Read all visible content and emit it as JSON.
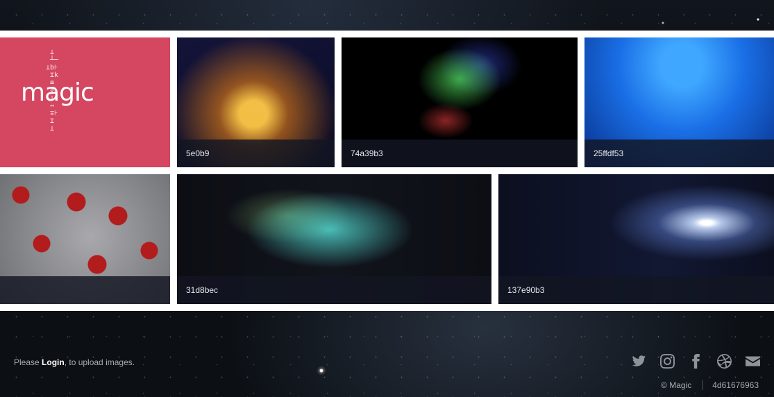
{
  "gallery": {
    "tiles": [
      {
        "logo_text": "magic"
      },
      {
        "caption": "5e0b9"
      },
      {
        "caption": "74a39b3"
      },
      {
        "caption": "25ffdf53"
      },
      {
        "caption": ""
      },
      {
        "caption": "31d8bec"
      },
      {
        "caption": "137e90b3"
      }
    ]
  },
  "footer": {
    "login_prefix": "Please ",
    "login_link": "Login",
    "login_suffix": ", to upload images.",
    "copyright": "© Magic",
    "hash": "4d61676963",
    "social_icons": [
      "twitter-icon",
      "instagram-icon",
      "facebook-icon",
      "dribbble-icon",
      "envelope-icon"
    ]
  },
  "colors": {
    "logo_tile_bg": "#d54660",
    "caption_bg": "#121622",
    "caption_text": "#e6e9ee",
    "footer_text": "#a5abb3",
    "icon_color": "#8f949b"
  }
}
